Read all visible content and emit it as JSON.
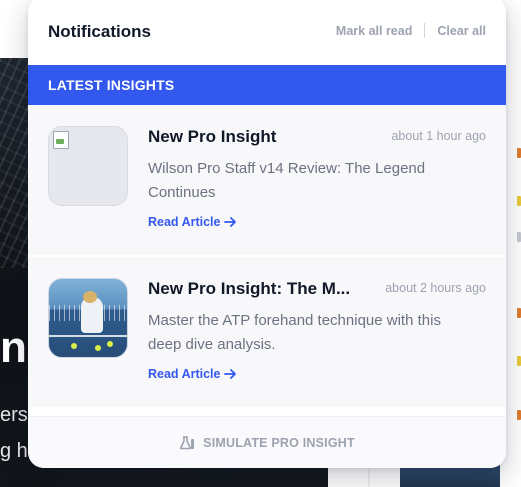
{
  "background": {
    "hero_char": "n",
    "hero_line_1": "ers",
    "hero_line_2": "g he"
  },
  "panel": {
    "title": "Notifications",
    "mark_all_read_label": "Mark all read",
    "clear_all_label": "Clear all",
    "section_label": "LATEST INSIGHTS",
    "footer_label": "SIMULATE PRO INSIGHT",
    "footer_icon": "flask-icon",
    "accent_color": "#3358ee"
  },
  "notifications": [
    {
      "title": "New Pro Insight",
      "time": "about 1 hour ago",
      "body": "Wilson Pro Staff v14 Review: The Legend Continues",
      "link_label": "Read Article",
      "thumbnail": "broken-image"
    },
    {
      "title": "New Pro Insight: The M...",
      "time": "about 2 hours ago",
      "body": "Master the ATP forehand technique with this deep dive analysis.",
      "link_label": "Read Article",
      "thumbnail": "tennis-player-photo"
    }
  ]
}
